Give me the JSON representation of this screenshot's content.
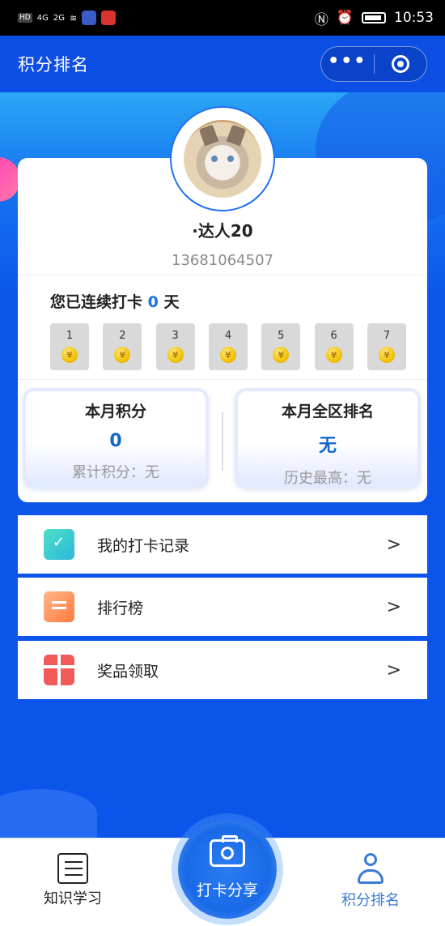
{
  "status_bar": {
    "left_badge": "HD",
    "signal1": "4G",
    "signal2": "2G",
    "time": "10:53"
  },
  "header": {
    "title": "积分排名",
    "menu_label": "•••"
  },
  "profile": {
    "username": "·达人20",
    "phone": "13681064507"
  },
  "streak": {
    "prefix": "您已连续打卡",
    "count": "0",
    "suffix": "天"
  },
  "days": [
    "1",
    "2",
    "3",
    "4",
    "5",
    "6",
    "7"
  ],
  "coin_glyph": "¥",
  "stats": {
    "monthly_points": {
      "title": "本月积分",
      "value": "0",
      "sub": "累计积分：无"
    },
    "monthly_rank": {
      "title": "本月全区排名",
      "value": "无",
      "sub": "历史最高：无"
    }
  },
  "menu": [
    {
      "label": "我的打卡记录",
      "icon": "checkin-record-icon"
    },
    {
      "label": "排行榜",
      "icon": "leaderboard-icon"
    },
    {
      "label": "奖品领取",
      "icon": "gift-icon"
    }
  ],
  "chevron": ">",
  "tabbar": {
    "left_label": "知识学习",
    "center_label": "打卡分享",
    "right_label": "积分排名"
  },
  "colors": {
    "primary_blue": "#0b55ea",
    "value_blue": "#1466c8",
    "active_tab": "#3a7bd5"
  }
}
